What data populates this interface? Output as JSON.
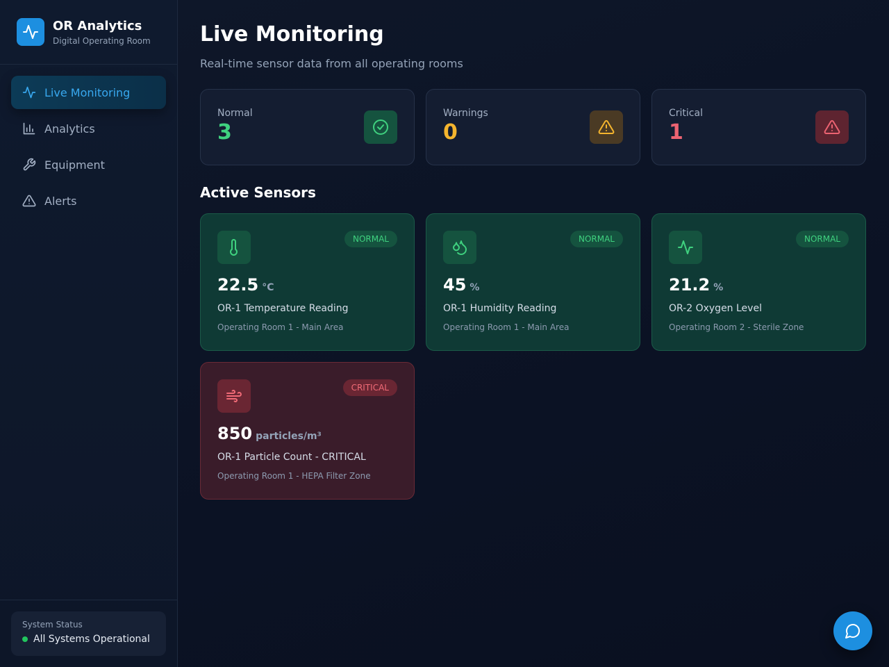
{
  "brand": {
    "title": "OR Analytics",
    "subtitle": "Digital Operating Room"
  },
  "nav": {
    "items": [
      {
        "label": "Live Monitoring",
        "icon": "activity-icon",
        "active": true
      },
      {
        "label": "Analytics",
        "icon": "bar-chart-icon"
      },
      {
        "label": "Equipment",
        "icon": "wrench-icon"
      },
      {
        "label": "Alerts",
        "icon": "alert-triangle-icon"
      }
    ]
  },
  "system": {
    "label": "System Status",
    "status": "All Systems Operational",
    "status_color": "#22c55e"
  },
  "page": {
    "title": "Live Monitoring",
    "subtitle": "Real-time sensor data from all operating rooms"
  },
  "stats": [
    {
      "label": "Normal",
      "value": "3",
      "color": "#3fd17f",
      "icon": "check-circle-icon"
    },
    {
      "label": "Warnings",
      "value": "0",
      "color": "#f5b52e",
      "icon": "alert-triangle-icon"
    },
    {
      "label": "Critical",
      "value": "1",
      "color": "#ec6372",
      "icon": "alert-triangle-icon"
    }
  ],
  "section": {
    "title": "Active Sensors"
  },
  "sensors": [
    {
      "status": "NORMAL",
      "value": "22.5",
      "unit": "°C",
      "name": "OR-1 Temperature Reading",
      "location": "Operating Room 1 - Main Area",
      "icon": "thermometer-icon"
    },
    {
      "status": "NORMAL",
      "value": "45",
      "unit": "%",
      "name": "OR-1 Humidity Reading",
      "location": "Operating Room 1 - Main Area",
      "icon": "droplets-icon"
    },
    {
      "status": "NORMAL",
      "value": "21.2",
      "unit": "%",
      "name": "OR-2 Oxygen Level",
      "location": "Operating Room 2 - Sterile Zone",
      "icon": "activity-icon"
    },
    {
      "status": "CRITICAL",
      "value": "850",
      "unit": "particles/m³",
      "name": "OR-1 Particle Count - CRITICAL",
      "location": "Operating Room 1 - HEPA Filter Zone",
      "icon": "wind-icon"
    }
  ],
  "colors": {
    "accent": "#1d8fe0",
    "normal": "#3fd17f",
    "warning": "#f5b52e",
    "critical": "#ec6372"
  },
  "chat": {
    "icon": "message-circle-icon"
  }
}
